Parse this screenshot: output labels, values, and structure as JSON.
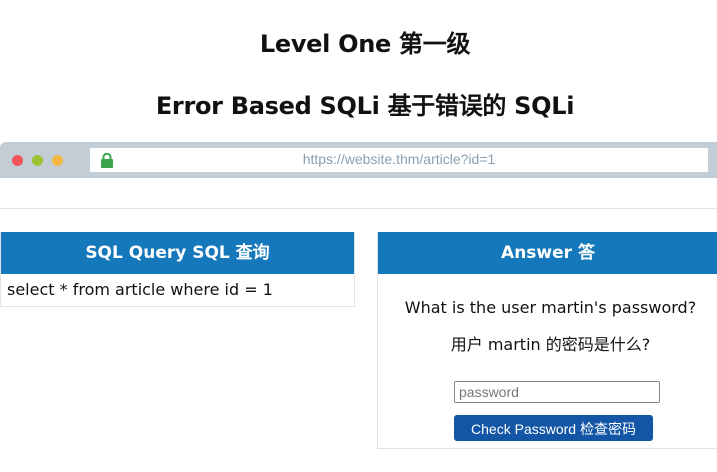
{
  "headings": {
    "level": "Level One  第一级",
    "subtitle": "Error Based SQLi  基于错误的 SQLi"
  },
  "browser": {
    "url": "https://website.thm/article?id=1",
    "window_dots": [
      "red",
      "yellow",
      "green"
    ],
    "lock_icon": "padlock-icon",
    "lock_color": "#3aa54a"
  },
  "sql_panel": {
    "title": "SQL Query  SQL 查询",
    "query": "select * from article where id = 1"
  },
  "answer_panel": {
    "title": "Answer  答",
    "question_en": "What is the user martin's password?",
    "question_zh": "用户 martin 的密码是什么?",
    "input_placeholder": "password",
    "input_value": "",
    "button_label": "Check Password  检查密码"
  },
  "colors": {
    "panel_header": "#1478bb",
    "button": "#1356a6",
    "browser_bar": "#c3cdd6"
  }
}
